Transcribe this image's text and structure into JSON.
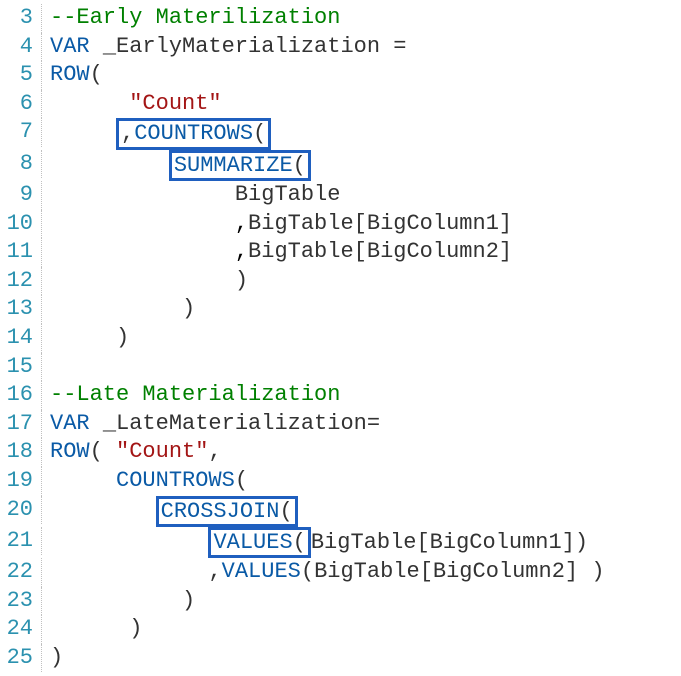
{
  "colors": {
    "comment": "#008000",
    "keyword": "#0a5aa6",
    "identifier": "#333333",
    "string": "#a31515",
    "gutter": "#2b91af",
    "highlight_border": "#1f5fbf"
  },
  "lines": {
    "l3": {
      "num": "3",
      "comment": "--Early Materilization"
    },
    "l4": {
      "num": "4",
      "kw_var": "VAR",
      "ident": "_EarlyMaterialization",
      "eq": " ="
    },
    "l5": {
      "num": "5",
      "kw_row": "ROW",
      "paren": "("
    },
    "l6": {
      "num": "6",
      "str": "\"Count\""
    },
    "l7": {
      "num": "7",
      "prefix": ",",
      "kw_hl": "COUNTROWS",
      "suffix": "("
    },
    "l8": {
      "num": "8",
      "kw_hl": "SUMMARIZE",
      "suffix": "("
    },
    "l9": {
      "num": "9",
      "ident": "BigTable"
    },
    "l10": {
      "num": "10",
      "ident_a": "BigTable",
      "col": "[BigColumn1]"
    },
    "l11": {
      "num": "11",
      "ident_a": "BigTable",
      "col": "[BigColumn2]"
    },
    "l12": {
      "num": "12",
      "paren": ")"
    },
    "l13": {
      "num": "13",
      "paren": ")"
    },
    "l14": {
      "num": "14",
      "paren": ")"
    },
    "l15": {
      "num": "15"
    },
    "l16": {
      "num": "16",
      "comment": "--Late Materialization"
    },
    "l17": {
      "num": "17",
      "kw_var": "VAR",
      "ident": "_LateMaterialization",
      "eq": "="
    },
    "l18": {
      "num": "18",
      "kw_row": "ROW",
      "paren": "( ",
      "str": "\"Count\"",
      "tail": ","
    },
    "l19": {
      "num": "19",
      "kw": "COUNTROWS",
      "suffix": "("
    },
    "l20": {
      "num": "20",
      "kw_hl": "CROSSJOIN",
      "suffix": "("
    },
    "l21": {
      "num": "21",
      "kw_hl": "VALUES",
      "suffix_a": "(",
      "ident_a": "BigTable",
      "col_a": "[BigColumn1]",
      "tail": ")"
    },
    "l22": {
      "num": "22",
      "prefix": ",",
      "kw": "VALUES",
      "suffix_a": "(",
      "ident_a": "BigTable",
      "col_a": "[BigColumn2]",
      "tail": " )"
    },
    "l23": {
      "num": "23",
      "paren": ")"
    },
    "l24": {
      "num": "24",
      "paren": ")"
    },
    "l25": {
      "num": "25",
      "paren": ")"
    }
  }
}
